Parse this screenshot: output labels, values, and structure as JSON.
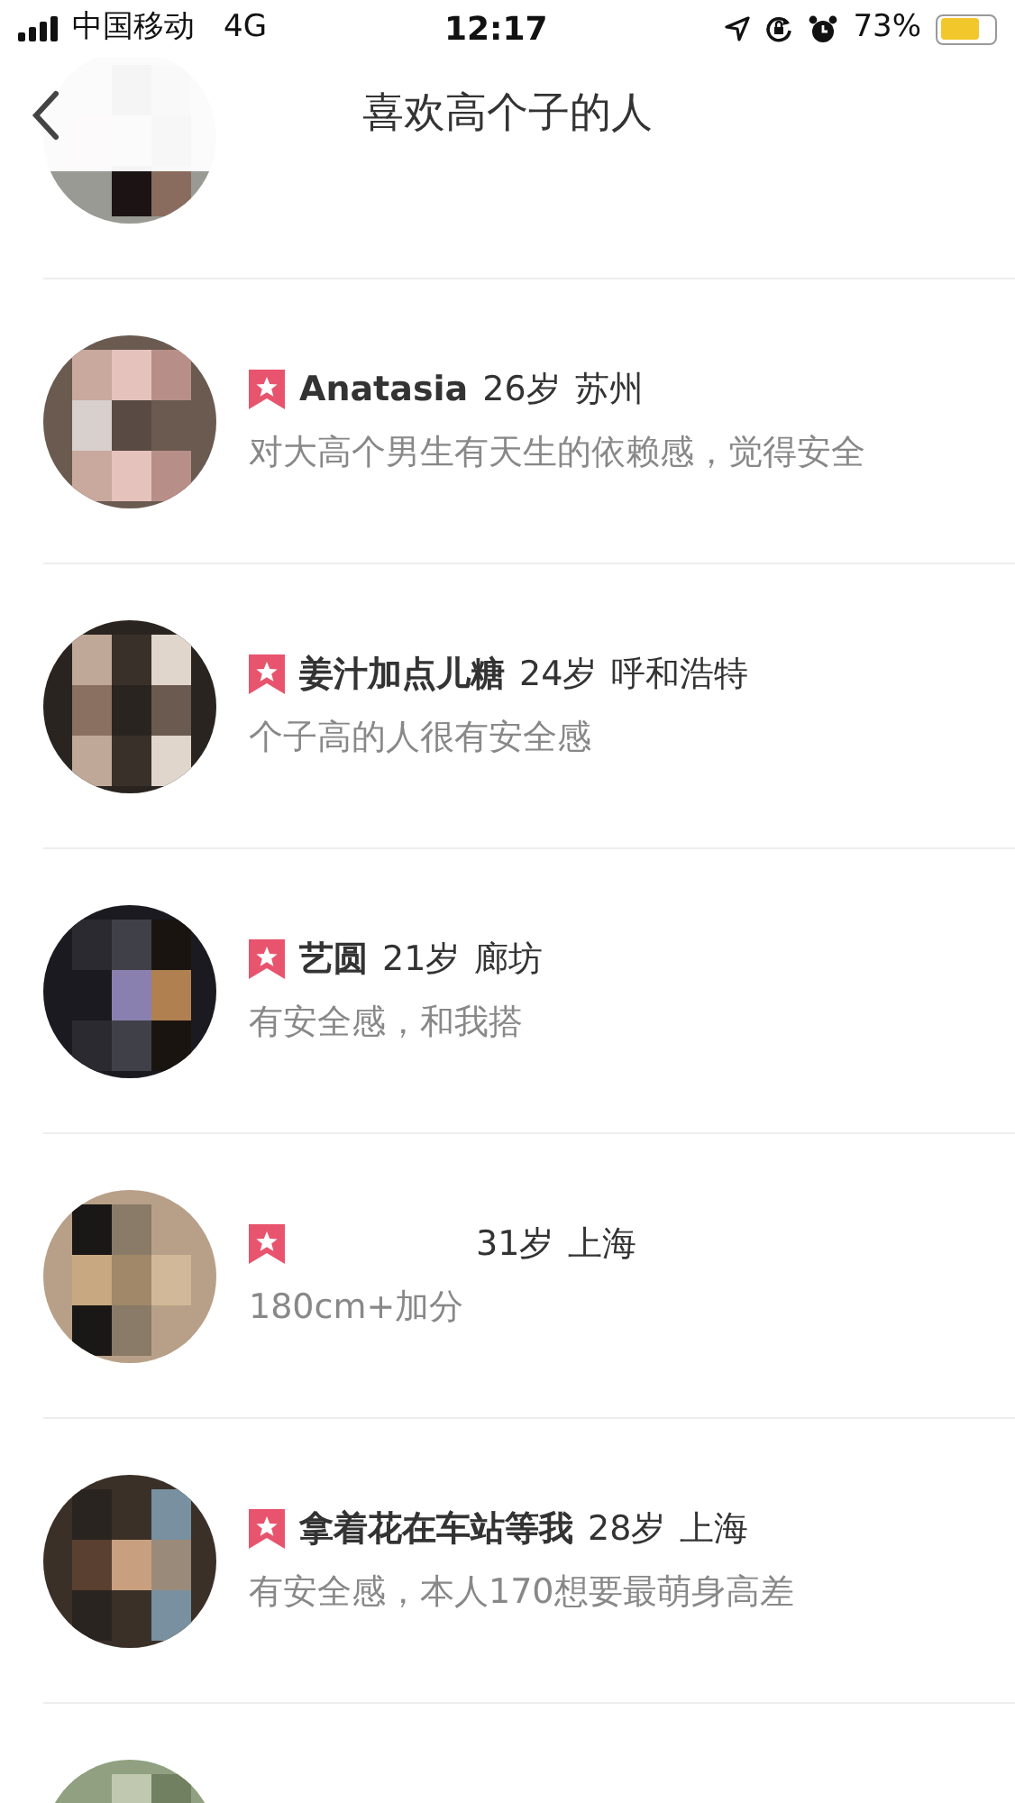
{
  "status_bar": {
    "carrier": "中国移动",
    "network": "4G",
    "time": "12:17",
    "battery_text": "73%",
    "battery": {
      "level": 0.73
    }
  },
  "nav": {
    "title": "喜欢高个子的人"
  },
  "users": [
    {
      "kind": "partial"
    },
    {
      "kind": "full",
      "name": "Anatasia",
      "age": "26岁",
      "city": "苏州",
      "bio": "对大高个男生有天生的依赖感，觉得安全"
    },
    {
      "kind": "full",
      "name": "姜汁加点儿糖",
      "age": "24岁",
      "city": "呼和浩特",
      "bio": "个子高的人很有安全感"
    },
    {
      "kind": "full",
      "name": "艺圆",
      "age": "21岁",
      "city": "廊坊",
      "bio": "有安全感，和我搭"
    },
    {
      "kind": "full",
      "age": "31岁",
      "city": "上海",
      "bio": "180cm+加分"
    },
    {
      "kind": "full",
      "name": "拿着花在车站等我",
      "age": "28岁",
      "city": "上海",
      "bio": "有安全感，本人170想要最萌身高差"
    },
    {
      "kind": "partial"
    }
  ]
}
